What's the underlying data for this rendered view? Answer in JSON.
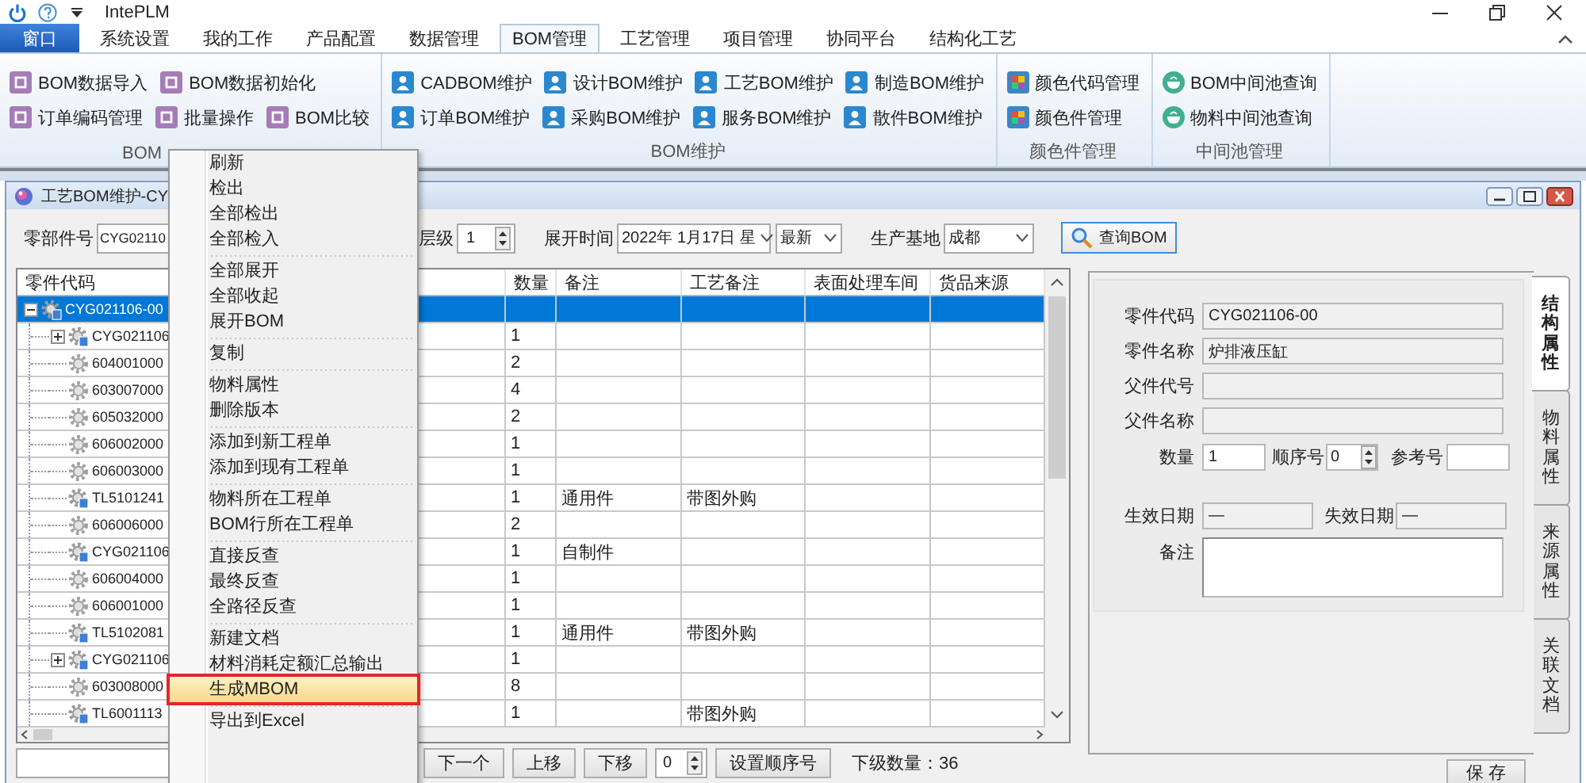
{
  "app": {
    "title": "IntePLM"
  },
  "menu_tabs": [
    {
      "label": "窗口",
      "kind": "app",
      "selected": false
    },
    {
      "label": "系统设置",
      "kind": "tab",
      "selected": false
    },
    {
      "label": "我的工作",
      "kind": "tab",
      "selected": false
    },
    {
      "label": "产品配置",
      "kind": "tab",
      "selected": false
    },
    {
      "label": "数据管理",
      "kind": "tab",
      "selected": false
    },
    {
      "label": "BOM管理",
      "kind": "tab",
      "selected": true
    },
    {
      "label": "工艺管理",
      "kind": "tab",
      "selected": false
    },
    {
      "label": "项目管理",
      "kind": "tab",
      "selected": false
    },
    {
      "label": "协同平台",
      "kind": "tab",
      "selected": false
    },
    {
      "label": "结构化工艺",
      "kind": "tab",
      "selected": false
    }
  ],
  "ribbon": {
    "groups": [
      {
        "label": "BOM",
        "kind": "operation",
        "rows": [
          [
            "BOM数据导入",
            "BOM数据初始化"
          ],
          [
            "订单编码管理",
            "批量操作",
            "BOM比较"
          ]
        ]
      },
      {
        "label": "BOM维护",
        "kind": "maintenance",
        "rows": [
          [
            "CADBOM维护",
            "设计BOM维护",
            "工艺BOM维护",
            "制造BOM维护"
          ],
          [
            "订单BOM维护",
            "采购BOM维护",
            "服务BOM维护",
            "散件BOM维护"
          ]
        ]
      },
      {
        "label": "颜色件管理",
        "kind": "color",
        "rows": [
          [
            "颜色代码管理"
          ],
          [
            "颜色件管理"
          ]
        ]
      },
      {
        "label": "中间池管理",
        "kind": "pool",
        "rows": [
          [
            "BOM中间池查询"
          ],
          [
            "物料中间池查询"
          ]
        ]
      }
    ]
  },
  "window": {
    "title": "工艺BOM维护-CY",
    "filter": {
      "part_no": {
        "label": "零部件号",
        "value": "CYG02110"
      },
      "level": {
        "label": "层级",
        "value": "1"
      },
      "expand_time": {
        "label": "展开时间",
        "value": "2022年 1月17日 星"
      },
      "version": {
        "value": "最新"
      },
      "base": {
        "label": "生产基地",
        "value": "成都"
      },
      "query_button": "查询BOM"
    },
    "table": {
      "columns": [
        "零件代码",
        "数量",
        "备注",
        "工艺备注",
        "表面处理车间",
        "货品来源"
      ],
      "rows": [
        {
          "code": "CYG021106-00",
          "kind": "assembly",
          "expanded": true,
          "selected": true,
          "children": [
            {
              "code": "CYG021106",
              "kind": "assembly",
              "expanded": false,
              "selected": false,
              "quantity": "1"
            },
            {
              "code": "604001000",
              "kind": "part",
              "selected": false,
              "quantity": "2"
            },
            {
              "code": "603007000",
              "kind": "part",
              "selected": false,
              "quantity": "4"
            },
            {
              "code": "605032000",
              "kind": "part",
              "selected": false,
              "quantity": "2"
            },
            {
              "code": "606002000",
              "kind": "part",
              "selected": false,
              "quantity": "1"
            },
            {
              "code": "606003000",
              "kind": "part",
              "selected": false,
              "quantity": "1"
            },
            {
              "code": "TL5101241",
              "kind": "assembly",
              "selected": false,
              "quantity": "1",
              "remark": "通用件",
              "process_remark": "带图外购"
            },
            {
              "code": "606006000",
              "kind": "part",
              "selected": false,
              "quantity": "2"
            },
            {
              "code": "CYG021106",
              "kind": "assembly",
              "selected": false,
              "quantity": "1",
              "remark": "自制件"
            },
            {
              "code": "606004000",
              "kind": "part",
              "selected": false,
              "quantity": "1"
            },
            {
              "code": "606001000",
              "kind": "part",
              "selected": false,
              "quantity": "1"
            },
            {
              "code": "TL5102081",
              "kind": "assembly",
              "selected": false,
              "quantity": "1",
              "remark": "通用件",
              "process_remark": "带图外购"
            },
            {
              "code": "CYG021106",
              "kind": "assembly",
              "expanded": false,
              "selected": false,
              "quantity": "1"
            },
            {
              "code": "603008000",
              "kind": "part",
              "selected": false,
              "quantity": "8"
            },
            {
              "code": "TL6001113",
              "kind": "assembly",
              "selected": false,
              "quantity": "1",
              "process_remark": "带图外购"
            }
          ]
        }
      ]
    },
    "toolbar": {
      "buttons": [
        "下一个",
        "上移",
        "下移"
      ],
      "sequence": "0",
      "set_button": "设置顺序号",
      "child_count": "下级数量：36"
    },
    "detail": {
      "fields": [
        {
          "label": "零件代码",
          "value": "CYG021106-00",
          "disabled": true
        },
        {
          "label": "零件名称",
          "value": "炉排液压缸",
          "disabled": true
        },
        {
          "label": "父件代号",
          "disabled": true
        },
        {
          "label": "父件名称",
          "disabled": true
        }
      ],
      "quantity": {
        "label": "数量",
        "value": "1",
        "disabled": false
      },
      "sequence": {
        "label": "顺序号",
        "value": "0"
      },
      "reference": {
        "label": "参考号",
        "disabled": false
      },
      "effective": {
        "label": "生效日期",
        "value": "—",
        "disabled": true
      },
      "expiry": {
        "label": "失效日期",
        "value": "—",
        "disabled": true
      },
      "remark": {
        "label": "备注",
        "disabled": false
      },
      "tabs": [
        {
          "label": "结构属性",
          "selected": true
        },
        {
          "label": "物料属性",
          "selected": false
        },
        {
          "label": "来源属性",
          "selected": false
        },
        {
          "label": "关联文档",
          "selected": false
        }
      ],
      "save_button": "保 存"
    }
  },
  "context_menu": {
    "groups": [
      {
        "items": [
          {
            "label": "刷新",
            "selected": false
          },
          {
            "label": "检出",
            "selected": false
          },
          {
            "label": "全部检出",
            "selected": false
          },
          {
            "label": "全部检入",
            "selected": false
          }
        ]
      },
      {
        "items": [
          {
            "label": "全部展开",
            "selected": false
          },
          {
            "label": "全部收起",
            "selected": false
          },
          {
            "label": "展开BOM",
            "selected": false
          }
        ]
      },
      {
        "items": [
          {
            "label": "复制",
            "selected": false
          }
        ]
      },
      {
        "items": [
          {
            "label": "物料属性",
            "selected": false
          },
          {
            "label": "删除版本",
            "selected": false
          }
        ]
      },
      {
        "items": [
          {
            "label": "添加到新工程单",
            "selected": false
          },
          {
            "label": "添加到现有工程单",
            "selected": false
          }
        ]
      },
      {
        "items": [
          {
            "label": "物料所在工程单",
            "selected": false
          },
          {
            "label": "BOM行所在工程单",
            "selected": false
          }
        ]
      },
      {
        "items": [
          {
            "label": "直接反查",
            "selected": false
          },
          {
            "label": "最终反查",
            "selected": false
          },
          {
            "label": "全路径反查",
            "selected": false
          }
        ]
      },
      {
        "items": [
          {
            "label": "新建文档",
            "selected": false
          },
          {
            "label": "材料消耗定额汇总输出",
            "selected": false
          },
          {
            "label": "生成MBOM",
            "selected": true
          }
        ]
      },
      {
        "items": [
          {
            "label": "导出到Excel",
            "selected": false
          }
        ]
      }
    ]
  }
}
